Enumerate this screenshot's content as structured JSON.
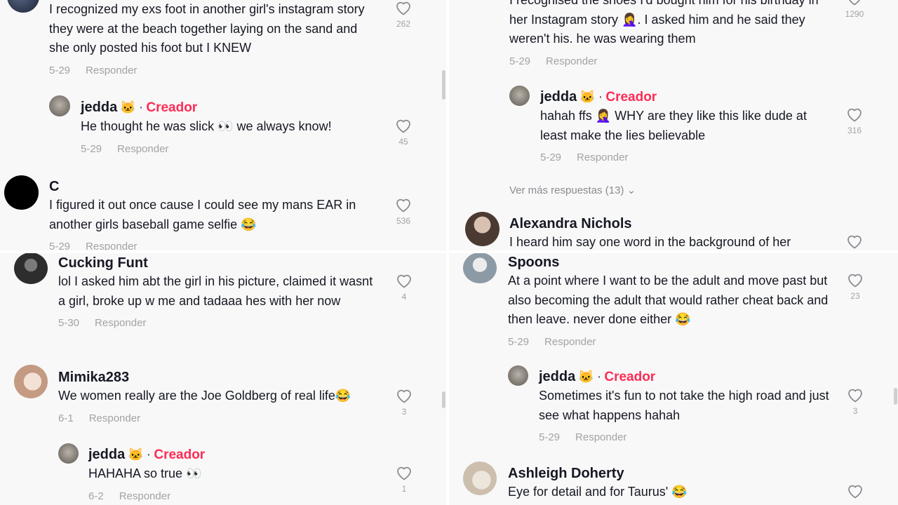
{
  "labels": {
    "reply": "Responder",
    "creator": "Creador",
    "view_more": "Ver más respuestas (13)"
  },
  "panel1": {
    "c1": {
      "text": "I recognized my exs foot in another girl's instagram story they were at the beach together laying on the sand and she only posted his foot but I KNEW",
      "date": "5-29",
      "likes": "262"
    },
    "r1": {
      "user": "jedda",
      "text": "He thought he was slick 👀 we always know!",
      "date": "5-29",
      "likes": "45"
    },
    "c2": {
      "user": "C",
      "text": "I figured it out once cause I could see my mans EAR in another girls baseball game selfie 😂",
      "date": "5-29",
      "likes": "536"
    }
  },
  "panel2": {
    "c1": {
      "text": "I recognised the shoes I'd bought him for his birthday in her Instagram story 🤦‍♀️. I asked him and he said they weren't his. he was wearing them",
      "date": "5-29",
      "likes": "1290"
    },
    "r1": {
      "user": "jedda",
      "text": "hahah ffs 🤦‍♀️ WHY are they like this like dude at least make the lies believable",
      "date": "5-29",
      "likes": "316"
    },
    "c2": {
      "user": "Alexandra Nichols",
      "text": "I heard him say one word in the background of her"
    }
  },
  "panel3": {
    "c1": {
      "user": "Cucking Funt",
      "text": "lol I asked him abt the girl in his picture, claimed it wasnt a girl, broke up w me and tadaaa hes with her now",
      "date": "5-30",
      "likes": "4"
    },
    "c2": {
      "user": "Mimika283",
      "text": "We women really are the Joe Goldberg of real life😂",
      "date": "6-1",
      "likes": "3"
    },
    "r1": {
      "user": "jedda",
      "text": "HAHAHA so true 👀",
      "date": "6-2",
      "likes": "1"
    }
  },
  "panel4": {
    "c1": {
      "user": "Spoons",
      "text": "At a point where I want to be the adult and move past but also becoming the adult that would rather cheat back and then leave. never done either 😂",
      "date": "5-29",
      "likes": "23"
    },
    "r1": {
      "user": "jedda",
      "text": "Sometimes it's fun to not take the high road and just see what happens hahah",
      "date": "5-29",
      "likes": "3"
    },
    "c2": {
      "user": "Ashleigh Doherty",
      "text": "Eye for detail and for Taurus' 😂"
    }
  },
  "colors": {
    "creator": "#fe2c55",
    "muted": "#a3a3a6",
    "background": "#f8f8f8"
  }
}
